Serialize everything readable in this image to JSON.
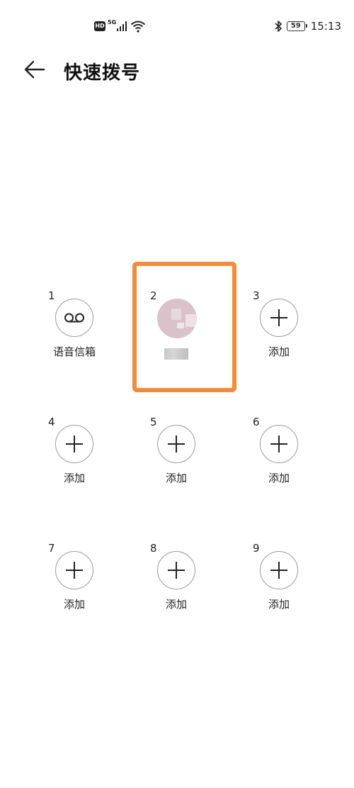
{
  "status_bar": {
    "hd": "HD",
    "network": "5G",
    "battery": "59",
    "time": "15:13"
  },
  "header": {
    "title": "快速拨号"
  },
  "slots": [
    {
      "number": "1",
      "label": "语音信箱",
      "icon": "voicemail-icon"
    },
    {
      "number": "2",
      "label": "",
      "icon": "contact-avatar"
    },
    {
      "number": "3",
      "label": "添加",
      "icon": "plus-icon"
    },
    {
      "number": "4",
      "label": "添加",
      "icon": "plus-icon"
    },
    {
      "number": "5",
      "label": "添加",
      "icon": "plus-icon"
    },
    {
      "number": "6",
      "label": "添加",
      "icon": "plus-icon"
    },
    {
      "number": "7",
      "label": "添加",
      "icon": "plus-icon"
    },
    {
      "number": "8",
      "label": "添加",
      "icon": "plus-icon"
    },
    {
      "number": "9",
      "label": "添加",
      "icon": "plus-icon"
    }
  ],
  "colors": {
    "highlight": "#f58a3a",
    "circle_border": "#9a9a9a"
  }
}
